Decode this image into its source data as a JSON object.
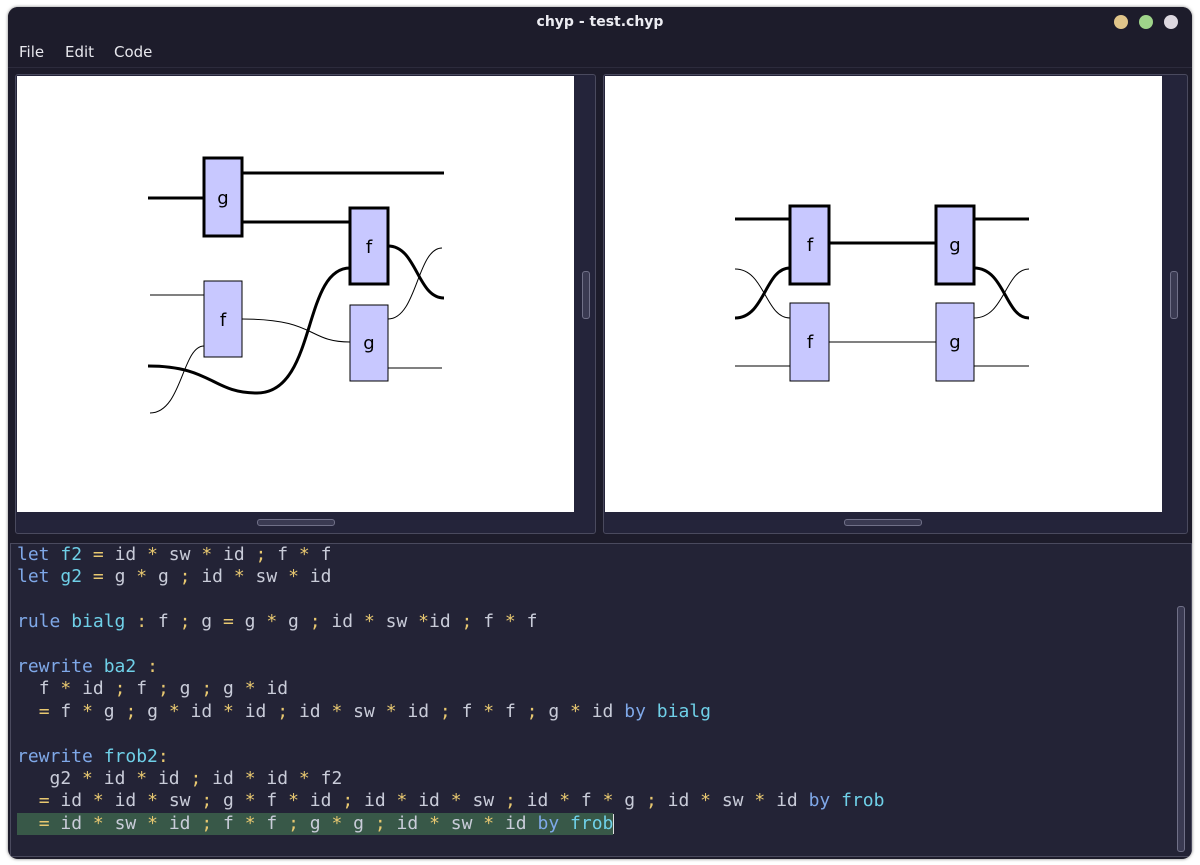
{
  "window": {
    "title": "chyp - test.chyp",
    "controls": [
      {
        "name": "minimize",
        "color": "#e0c58a"
      },
      {
        "name": "maximize",
        "color": "#9fd48a"
      },
      {
        "name": "close",
        "color": "#ddd8e0"
      }
    ]
  },
  "menu": {
    "items": [
      "File",
      "Edit",
      "Code"
    ]
  },
  "diagrams": {
    "box_fill": "#c8c8ff",
    "left": {
      "boxes": [
        {
          "label": "g"
        },
        {
          "label": "f"
        },
        {
          "label": "f"
        },
        {
          "label": "g"
        }
      ]
    },
    "right": {
      "boxes": [
        {
          "label": "f"
        },
        {
          "label": "g"
        },
        {
          "label": "f"
        },
        {
          "label": "g"
        }
      ]
    }
  },
  "editor": {
    "lines": [
      {
        "text": "let f2 = id * sw * id ; f * f"
      },
      {
        "text": "let g2 = g * g ; id * sw * id"
      },
      {
        "text": ""
      },
      {
        "text": "rule bialg : f ; g = g * g ; id * sw *id ; f * f"
      },
      {
        "text": ""
      },
      {
        "text": "rewrite ba2 :"
      },
      {
        "text": "  f * id ; f ; g ; g * id"
      },
      {
        "text": "  = f * g ; g * id * id ; id * sw * id ; f * f ; g * id by bialg"
      },
      {
        "text": ""
      },
      {
        "text": "rewrite frob2:"
      },
      {
        "text": "   g2 * id * id ; id * id * f2"
      },
      {
        "text": "  = id * id * sw ; g * f * id ; id * id * sw ; id * f * g ; id * sw * id by frob"
      },
      {
        "text": "  = id * sw * id ; f * f ; g * g ; id * sw * id by frob",
        "highlighted": true
      }
    ],
    "colors": {
      "keyword": "#7fa8e8",
      "name": "#6fd0e8",
      "operator": "#e8c870",
      "text": "#c9ccd9",
      "highlight": "#385848"
    }
  }
}
